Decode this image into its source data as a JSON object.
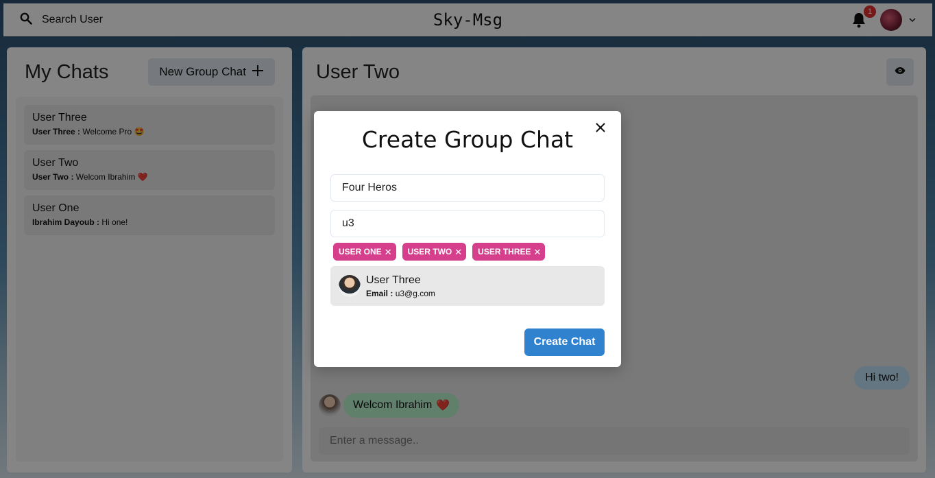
{
  "topbar": {
    "search_label": "Search User",
    "app_title": "Sky-Msg",
    "notification_count": "1"
  },
  "left_panel": {
    "title": "My Chats",
    "new_group_label": "New Group Chat",
    "chats": [
      {
        "name": "User Three",
        "sender": "User Three :",
        "message": "Welcome Pro",
        "emoji": "🤩"
      },
      {
        "name": "User Two",
        "sender": "User Two :",
        "message": "Welcom Ibrahim",
        "emoji": "❤️"
      },
      {
        "name": "User One",
        "sender": "Ibrahim Dayoub :",
        "message": "Hi one!",
        "emoji": ""
      }
    ]
  },
  "right_panel": {
    "title": "User Two",
    "messages": {
      "sent": "Hi two!",
      "received": "Welcom Ibrahim",
      "received_emoji": "❤️"
    },
    "input_placeholder": "Enter a message.."
  },
  "modal": {
    "title": "Create Group Chat",
    "group_name_value": "Four Heros",
    "search_value": "u3",
    "selected_users": [
      "USER ONE",
      "USER TWO",
      "USER THREE"
    ],
    "result": {
      "name": "User Three",
      "email_label": "Email :",
      "email": "u3@g.com"
    },
    "create_label": "Create Chat"
  },
  "colors": {
    "tag": "#d53f8c",
    "primary_button": "#3182ce",
    "sent_bubble": "#bee3f8",
    "received_bubble": "#b9f5d0"
  }
}
